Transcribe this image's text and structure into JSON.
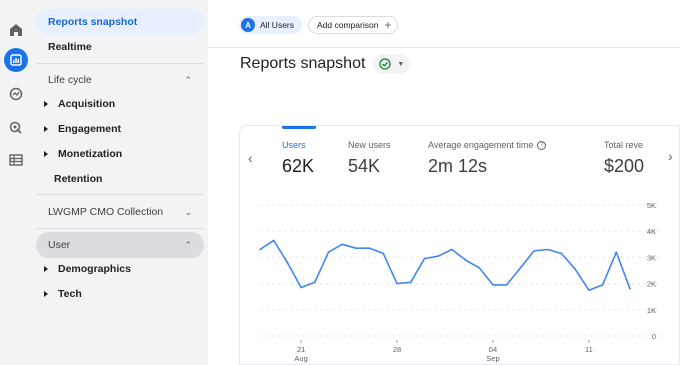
{
  "sidebar": {
    "reports_snapshot": "Reports snapshot",
    "realtime": "Realtime",
    "lifecycle_section": "Life cycle",
    "lifecycle_items": [
      "Acquisition",
      "Engagement",
      "Monetization"
    ],
    "retention": "Retention",
    "collection_section": "LWGMP CMO Collection",
    "user_section": "User",
    "user_items": [
      "Demographics",
      "Tech"
    ]
  },
  "topbar": {
    "audience_badge": "A",
    "audience_label": "All Users",
    "compare_label": "Add comparison",
    "compare_icon": "+"
  },
  "page": {
    "title": "Reports snapshot"
  },
  "metrics": [
    {
      "label": "Users",
      "value": "62K"
    },
    {
      "label": "New users",
      "value": "54K"
    },
    {
      "label": "Average engagement time",
      "value": "2m 12s"
    },
    {
      "label": "Total reve",
      "value": "$200"
    }
  ],
  "colors": {
    "accent": "#1a73e8",
    "line": "#4285f4",
    "status_green": "#188038"
  },
  "chart_data": {
    "type": "line",
    "series": [
      {
        "values": [
          3300,
          3650,
          2800,
          1850,
          2050,
          3200,
          3500,
          3350,
          3350,
          3150,
          2000,
          2050,
          2950,
          3050,
          3300,
          2900,
          2600,
          1950,
          1950,
          2600,
          3250,
          3300,
          3150,
          2550,
          1750,
          1950,
          3200,
          1800
        ]
      }
    ],
    "x_tick_labels": [
      {
        "label": "21",
        "sub": "Aug",
        "index": 3
      },
      {
        "label": "28",
        "sub": "",
        "index": 10
      },
      {
        "label": "04",
        "sub": "Sep",
        "index": 17
      },
      {
        "label": "11",
        "sub": "",
        "index": 24
      }
    ],
    "y_ticks": [
      "0",
      "1K",
      "2K",
      "3K",
      "4K",
      "5K"
    ],
    "ylim": [
      0,
      5000
    ],
    "grid": true
  }
}
